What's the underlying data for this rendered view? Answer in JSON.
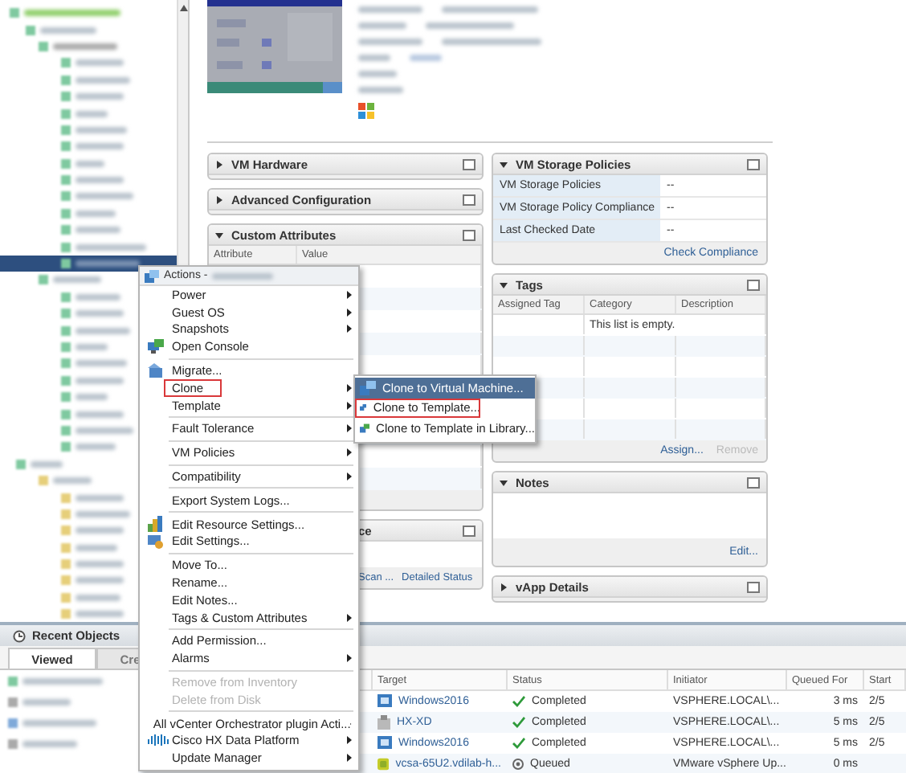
{
  "portlets_left": [
    {
      "kind": "plain",
      "title": "VM Hardware",
      "expanded": false
    },
    {
      "kind": "plain",
      "title": "Advanced Configuration",
      "expanded": false
    },
    {
      "kind": "attributes",
      "title": "Custom Attributes",
      "expanded": true,
      "columns": [
        "Attribute",
        "Value"
      ]
    },
    {
      "kind": "compliance",
      "title": "ce",
      "links": [
        "Scan ...",
        "Detailed Status"
      ]
    }
  ],
  "portlets_right": [
    {
      "kind": "policies",
      "title": "VM Storage Policies",
      "expanded": true,
      "rows": [
        {
          "label": "VM Storage Policies",
          "value": "--"
        },
        {
          "label": "VM Storage Policy Compliance",
          "value": "--"
        },
        {
          "label": "Last Checked Date",
          "value": "--"
        }
      ],
      "link": "Check Compliance"
    },
    {
      "kind": "tags",
      "title": "Tags",
      "expanded": true,
      "columns": [
        "Assigned Tag",
        "Category",
        "Description"
      ],
      "empty_text": "This list is empty.",
      "actions": [
        {
          "label": "Assign...",
          "disabled": false
        },
        {
          "label": "Remove",
          "disabled": true
        }
      ]
    },
    {
      "kind": "notes",
      "title": "Notes",
      "expanded": true,
      "link": "Edit..."
    },
    {
      "kind": "plain",
      "title": "vApp Details",
      "expanded": false
    }
  ],
  "recent_objects": {
    "title": "Recent Objects",
    "tabs": [
      {
        "label": "Viewed",
        "selected": true
      },
      {
        "label": "Cre",
        "selected": false
      }
    ]
  },
  "tasks": {
    "columns": [
      "Target",
      "Status",
      "Initiator",
      "Queued For",
      "Start"
    ],
    "rows": [
      {
        "target": {
          "text": "Windows2016",
          "kind": "vm"
        },
        "status": {
          "text": "Completed",
          "kind": "done"
        },
        "initiator": "VSPHERE.LOCAL\\...",
        "queued": "3 ms",
        "start": "2/5"
      },
      {
        "target": {
          "text": "HX-XD",
          "kind": "host"
        },
        "status": {
          "text": "Completed",
          "kind": "done"
        },
        "initiator": "VSPHERE.LOCAL\\...",
        "queued": "5 ms",
        "start": "2/5"
      },
      {
        "target": {
          "text": "Windows2016",
          "kind": "vm"
        },
        "status": {
          "text": "Completed",
          "kind": "done"
        },
        "initiator": "VSPHERE.LOCAL\\...",
        "queued": "5 ms",
        "start": "2/5"
      },
      {
        "target": {
          "text": "vcsa-65U2.vdilab-h...",
          "kind": "appliance"
        },
        "status": {
          "text": "Queued",
          "kind": "queued"
        },
        "initiator": "VMware vSphere Up...",
        "queued": "0 ms"
      }
    ]
  },
  "menu": {
    "title": "Actions -",
    "items": [
      {
        "kind": "item",
        "label": "Power",
        "submenu": true
      },
      {
        "kind": "item",
        "label": "Guest OS",
        "submenu": true
      },
      {
        "kind": "item",
        "label": "Snapshots",
        "submenu": true
      },
      {
        "kind": "item",
        "label": "Open Console"
      },
      {
        "kind": "separator"
      },
      {
        "kind": "item",
        "label": "Migrate..."
      },
      {
        "kind": "item",
        "label": "Clone",
        "submenu": true,
        "outlined": true
      },
      {
        "kind": "item",
        "label": "Template",
        "submenu": true
      },
      {
        "kind": "separator"
      },
      {
        "kind": "item",
        "label": "Fault Tolerance",
        "submenu": true
      },
      {
        "kind": "separator"
      },
      {
        "kind": "item",
        "label": "VM Policies",
        "submenu": true
      },
      {
        "kind": "separator"
      },
      {
        "kind": "item",
        "label": "Compatibility",
        "submenu": true
      },
      {
        "kind": "separator"
      },
      {
        "kind": "item",
        "label": "Export System Logs..."
      },
      {
        "kind": "separator"
      },
      {
        "kind": "item",
        "label": "Edit Resource Settings..."
      },
      {
        "kind": "item",
        "label": "Edit Settings..."
      },
      {
        "kind": "separator"
      },
      {
        "kind": "item",
        "label": "Move To..."
      },
      {
        "kind": "item",
        "label": "Rename..."
      },
      {
        "kind": "item",
        "label": "Edit Notes..."
      },
      {
        "kind": "item",
        "label": "Tags & Custom Attributes",
        "submenu": true
      },
      {
        "kind": "separator"
      },
      {
        "kind": "item",
        "label": "Add Permission..."
      },
      {
        "kind": "item",
        "label": "Alarms",
        "submenu": true
      },
      {
        "kind": "separator"
      },
      {
        "kind": "item",
        "label": "Remove from Inventory",
        "disabled": true
      },
      {
        "kind": "item",
        "label": "Delete from Disk",
        "disabled": true
      },
      {
        "kind": "separator"
      },
      {
        "kind": "item",
        "label": "All vCenter Orchestrator plugin Acti...",
        "submenu": true
      },
      {
        "kind": "item",
        "label": "Cisco HX Data Platform",
        "submenu": true
      },
      {
        "kind": "item",
        "label": "Update Manager",
        "submenu": true
      }
    ],
    "submenu": [
      {
        "label": "Clone to Virtual Machine...",
        "selected": true,
        "outlined": false
      },
      {
        "label": "Clone to Template...",
        "selected": false,
        "outlined": true
      },
      {
        "label": "Clone to Template in Library...",
        "selected": false,
        "outlined": false
      }
    ]
  }
}
